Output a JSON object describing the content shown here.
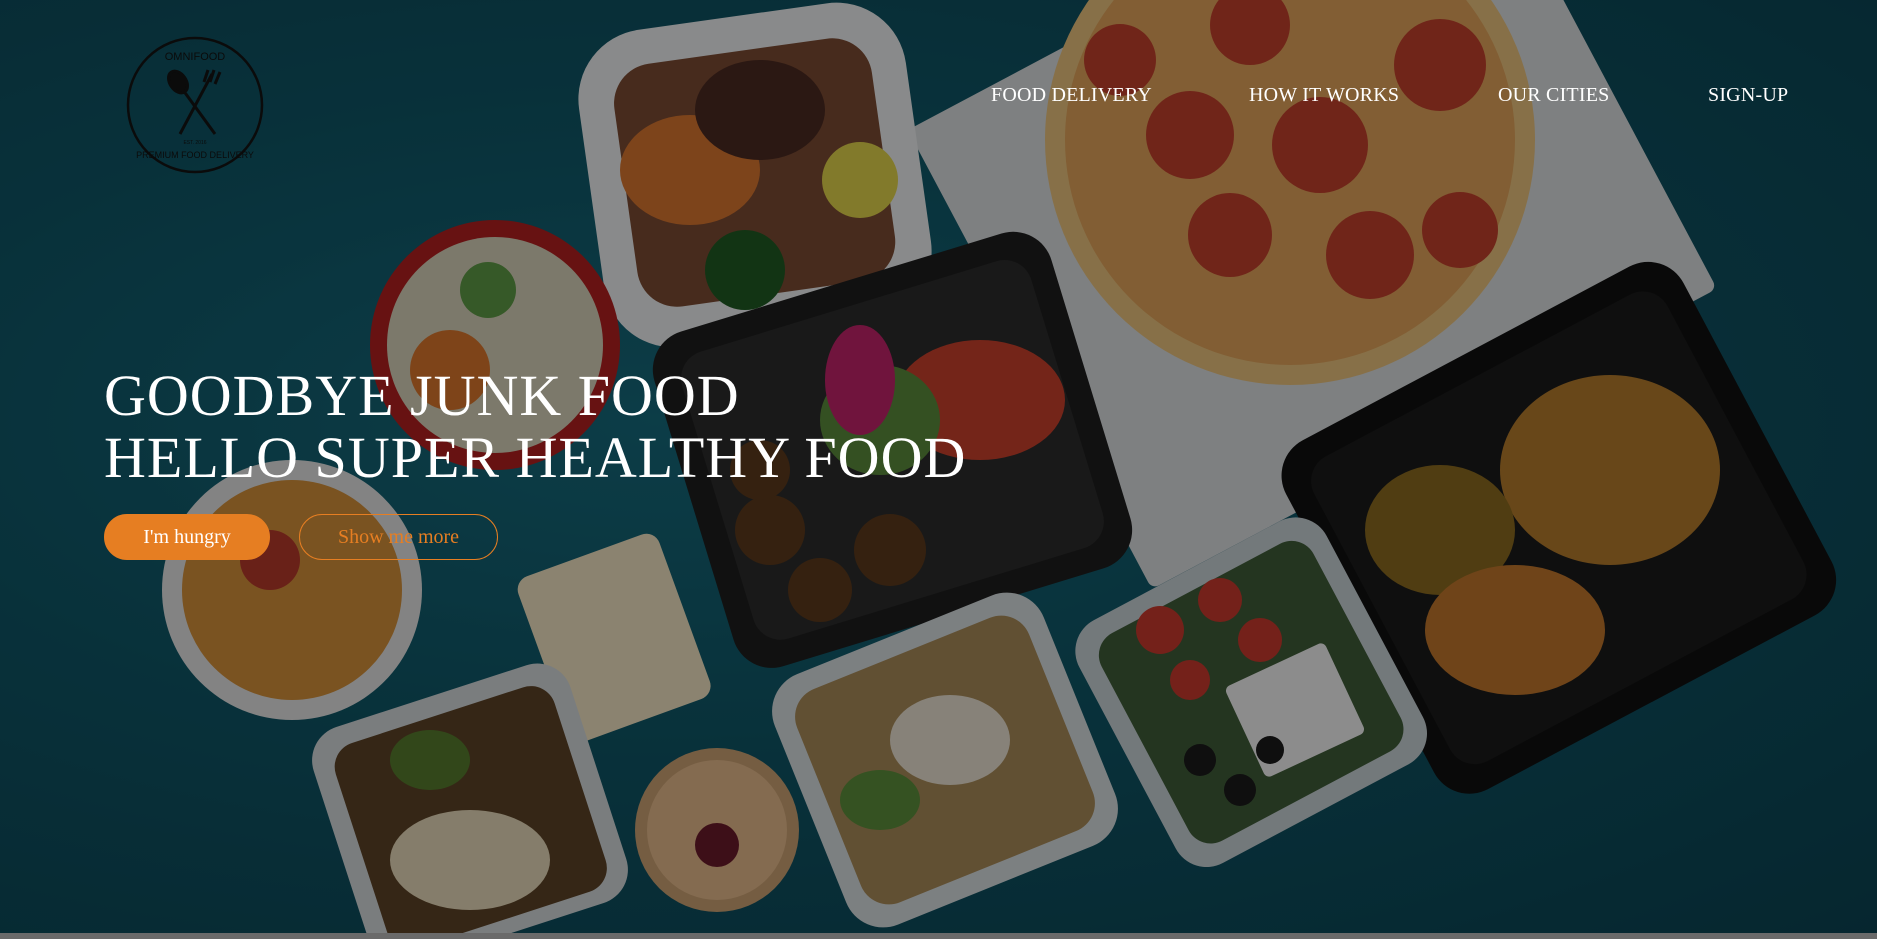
{
  "logo": {
    "brand_text": "OMNIFOOD",
    "tagline_text": "PREMIUM FOOD DELIVERY",
    "est_text": "EST. 2016",
    "icon": "fork-spoon-icon"
  },
  "nav": {
    "items": [
      {
        "label": "FOOD DELIVERY"
      },
      {
        "label": "HOW IT WORKS"
      },
      {
        "label": "OUR CITIES"
      },
      {
        "label": "SIGN-UP"
      }
    ]
  },
  "hero": {
    "headline_line1": "GOODBYE JUNK FOOD",
    "headline_line2": "HELLO SUPER HEALTHY FOOD",
    "primary_button": "I'm hungry",
    "secondary_button": "Show me more"
  },
  "colors": {
    "accent": "#e67e22",
    "background": "#0f5565",
    "text": "#ffffff"
  }
}
